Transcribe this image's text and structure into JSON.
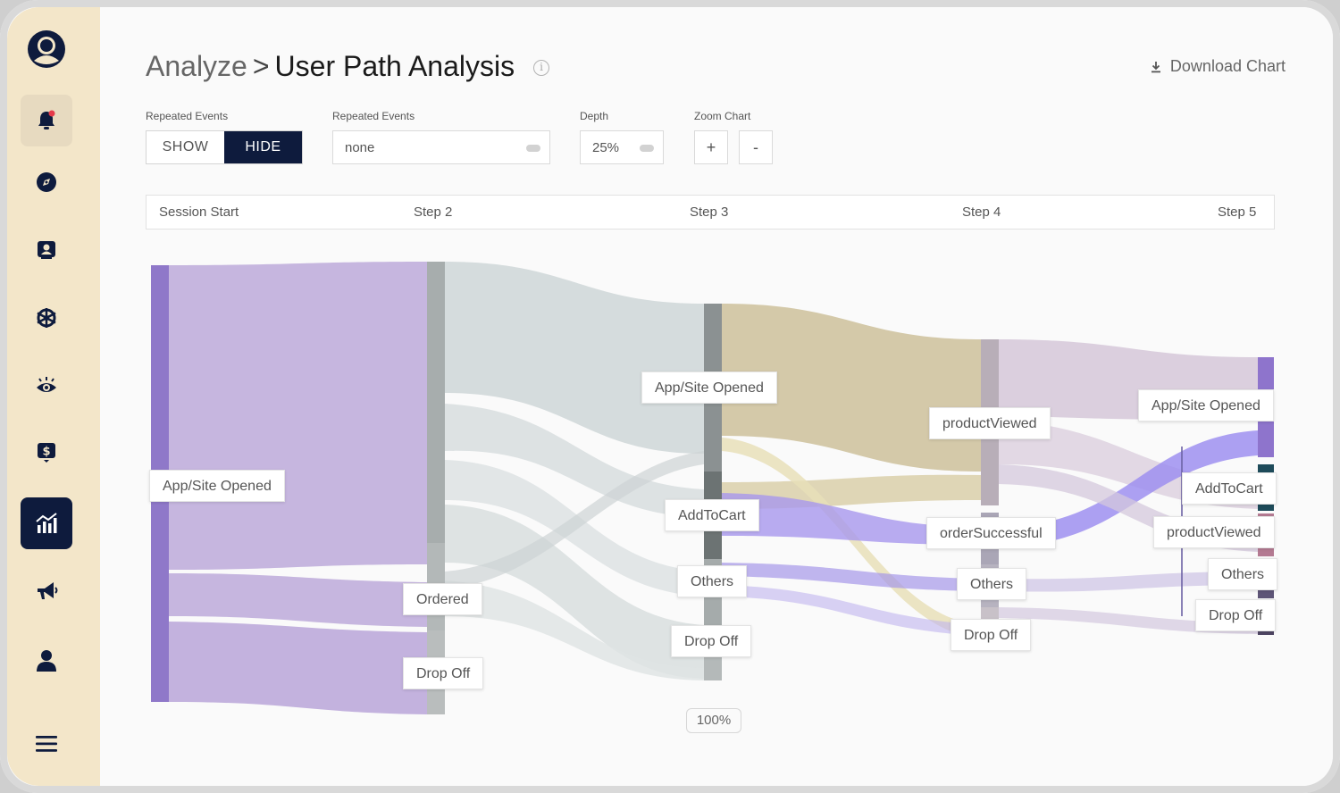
{
  "header": {
    "crumb": "Analyze",
    "separator": ">",
    "title": "User Path Analysis",
    "download_label": "Download Chart"
  },
  "controls": {
    "repeated_events_label": "Repeated Events",
    "toggle_show": "SHOW",
    "toggle_hide": "HIDE",
    "toggle_selected": "HIDE",
    "repeated_events_label_2": "Repeated Events",
    "repeated_events_value": "none",
    "depth_label": "Depth",
    "depth_value": "25%",
    "zoom_label": "Zoom Chart",
    "zoom_in": "+",
    "zoom_out": "-"
  },
  "steps": [
    "Session Start",
    "Step 2",
    "Step 3",
    "Step 4",
    "Step 5"
  ],
  "nodes": {
    "s1_app": "App/Site Opened",
    "s2_ordered": "Ordered",
    "s2_dropoff": "Drop Off",
    "s3_app": "App/Site Opened",
    "s3_addtocart": "AddToCart",
    "s3_others": "Others",
    "s3_dropoff": "Drop Off",
    "s4_productviewed": "productViewed",
    "s4_ordersuccessful": "orderSuccessful",
    "s4_others": "Others",
    "s4_dropoff": "Drop Off",
    "s5_app": "App/Site Opened",
    "s5_addtocart": "AddToCart",
    "s5_productviewed": "productViewed",
    "s5_others": "Others",
    "s5_dropoff": "Drop Off"
  },
  "footer": {
    "percent": "100%"
  },
  "colors": {
    "navy": "#0e1b3d",
    "sidebar": "#f3e6c9",
    "purple_flow": "#c6b6df",
    "grey_flow": "#d3dadb",
    "tan_flow": "#d2c6a4",
    "lilac_flow": "#d9ccdc",
    "violet": "#8f78c9",
    "notification_dot": "#e53b4b"
  },
  "sidebar_icons": [
    "logo-icon",
    "bell-icon",
    "compass-icon",
    "profile-card-icon",
    "network-icon",
    "eye-icon",
    "dollar-icon",
    "chart-icon",
    "megaphone-icon",
    "user-icon",
    "menu-icon"
  ]
}
